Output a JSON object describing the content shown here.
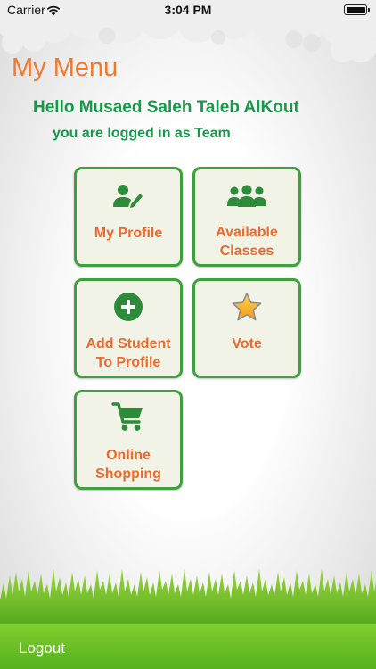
{
  "status_bar": {
    "carrier": "Carrier",
    "time": "3:04 PM"
  },
  "header": {
    "title": "My Menu",
    "greeting": "Hello Musaed Saleh Taleb AlKout",
    "role_line": "you are logged in as Team"
  },
  "menu": {
    "my_profile": {
      "line1": "My Profile",
      "icon": "profile-edit-icon"
    },
    "available_classes": {
      "line1": "Available",
      "line2": "Classes",
      "icon": "group-icon"
    },
    "add_student": {
      "line1": "Add Student",
      "line2": "To Profile",
      "icon": "plus-circle-icon"
    },
    "vote": {
      "line1": "Vote",
      "icon": "star-icon"
    },
    "online_shopping": {
      "line1": "Online",
      "line2": "Shopping",
      "icon": "cart-icon"
    }
  },
  "footer": {
    "logout": "Logout"
  },
  "colors": {
    "accent_orange": "#ec6a2e",
    "brand_green": "#17994a",
    "tile_border": "#3fa040",
    "footer_green": "#6cc027"
  }
}
